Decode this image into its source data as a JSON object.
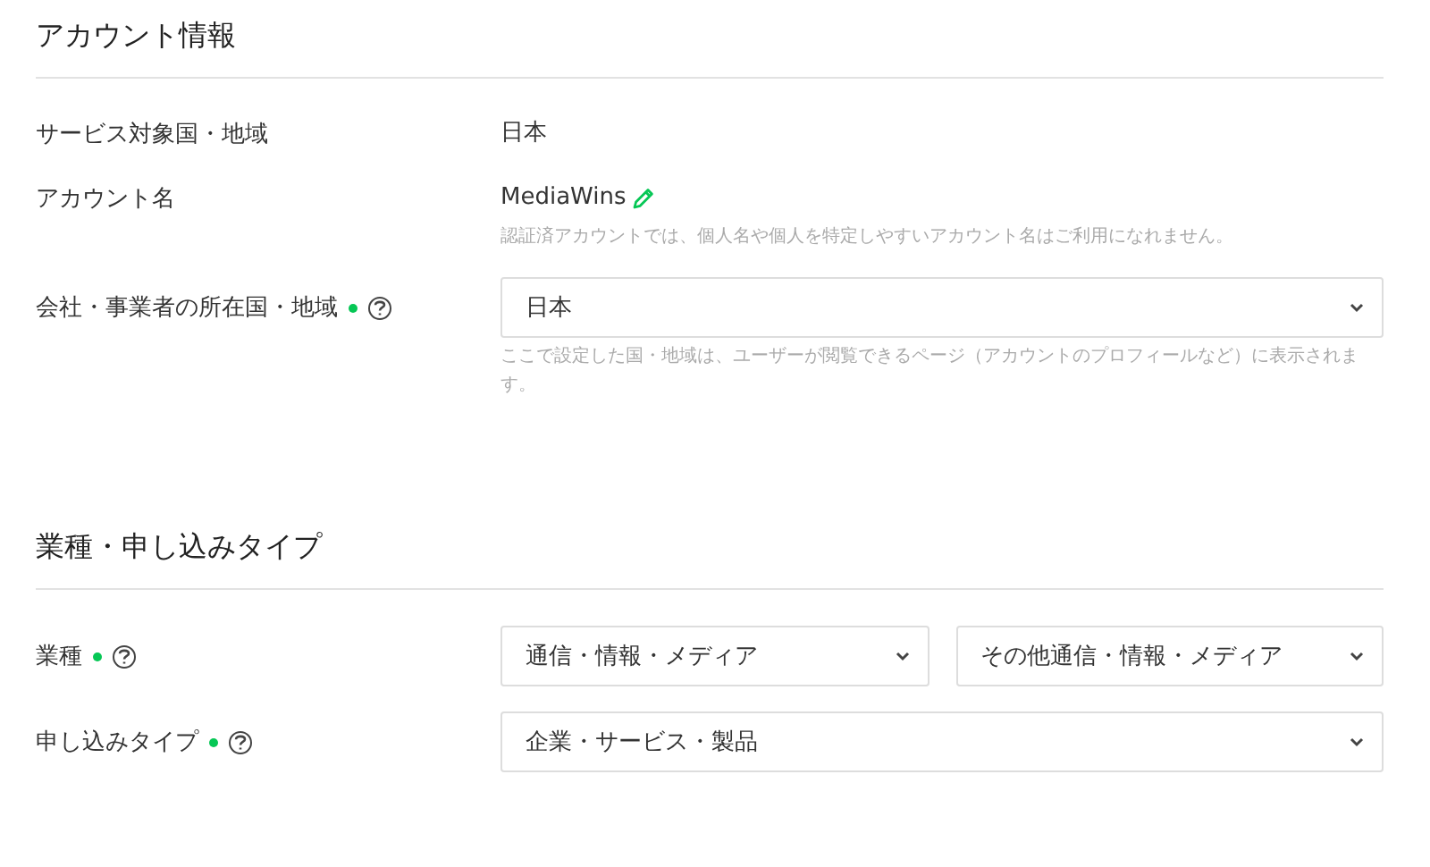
{
  "sections": [
    {
      "title": "アカウント情報",
      "rows": [
        {
          "kind": "text",
          "label": "サービス対象国・地域",
          "required": false,
          "help": false,
          "value": "日本"
        },
        {
          "kind": "editable",
          "label": "アカウント名",
          "required": false,
          "help": false,
          "value": "MediaWins",
          "note": "認証済アカウントでは、個人名や個人を特定しやすいアカウント名はご利用になれません。"
        },
        {
          "kind": "select",
          "label": "会社・事業者の所在国・地域",
          "required": true,
          "help": true,
          "values": [
            "日本"
          ],
          "note": "ここで設定した国・地域は、ユーザーが閲覧できるページ（アカウントのプロフィールなど）に表示されます。"
        }
      ]
    },
    {
      "title": "業種・申し込みタイプ",
      "rows": [
        {
          "kind": "select",
          "label": "業種",
          "required": true,
          "help": true,
          "values": [
            "通信・情報・メディア",
            "その他通信・情報・メディア"
          ]
        },
        {
          "kind": "select",
          "label": "申し込みタイプ",
          "required": true,
          "help": true,
          "values": [
            "企業・サービス・製品"
          ]
        }
      ]
    }
  ]
}
